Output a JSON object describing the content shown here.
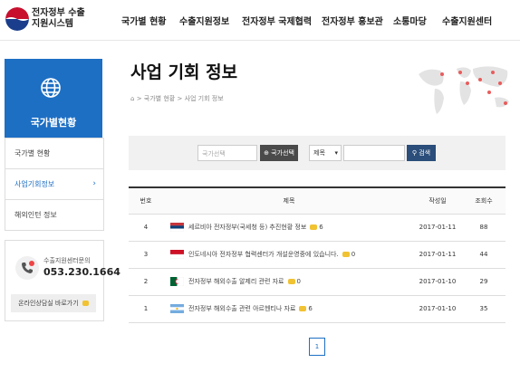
{
  "header": {
    "logo_line1": "전자정부 수출",
    "logo_line2": "지원시스템",
    "nav": [
      "국가별 현황",
      "수출지원정보",
      "전자정부 국제협력",
      "전자정부 홍보관",
      "소통마당",
      "수출지원센터"
    ]
  },
  "sidebar": {
    "title": "국가별현황",
    "items": [
      {
        "label": "국가별 현황"
      },
      {
        "label": "사업기회정보"
      },
      {
        "label": "해외인턴 정보"
      }
    ],
    "active_arrow": "›",
    "call_label": "수출지원센터문의",
    "call_number": "053.230.1664",
    "chat_label": "온라인상담실 바로가기"
  },
  "main": {
    "title": "사업 기회 정보",
    "breadcrumb_home": "⌂",
    "breadcrumb": [
      "국가별 현황",
      "사업 기회 정보"
    ],
    "breadcrumb_sep": ">"
  },
  "search": {
    "country_placeholder": "국가선택",
    "country_button": "국가선택",
    "field_select": "제목",
    "search_button": "검색"
  },
  "table": {
    "headers": {
      "no": "번호",
      "title": "제목",
      "date": "작성일",
      "views": "조회수"
    },
    "rows": [
      {
        "no": "4",
        "flag": "serbia",
        "title": "세르비아 전자정부(국세청 등) 추진현황 정보",
        "comments": "6",
        "date": "2017-01-11",
        "views": "88"
      },
      {
        "no": "3",
        "flag": "indonesia",
        "title": "인도네시아 전자정부 협력센터가 개설운영중에 있습니다.",
        "comments": "0",
        "date": "2017-01-11",
        "views": "44"
      },
      {
        "no": "2",
        "flag": "algeria",
        "title": "전자정부 해외수출 알제리 관련 자료",
        "comments": "0",
        "date": "2017-01-10",
        "views": "29"
      },
      {
        "no": "1",
        "flag": "argentina",
        "title": "전자정부 해외수출 관련 아르헨티나 자료",
        "comments": "6",
        "date": "2017-01-10",
        "views": "35"
      }
    ]
  },
  "pagination": {
    "current": "1"
  },
  "colors": {
    "accent": "#1d6fc4",
    "search_btn": "#2b4e7a",
    "comment_icon": "#f1c232"
  },
  "icons": [
    "government-logo-icon",
    "globe-icon",
    "phone-icon",
    "chat-icon",
    "search-icon",
    "world-map-icon",
    "home-icon"
  ]
}
